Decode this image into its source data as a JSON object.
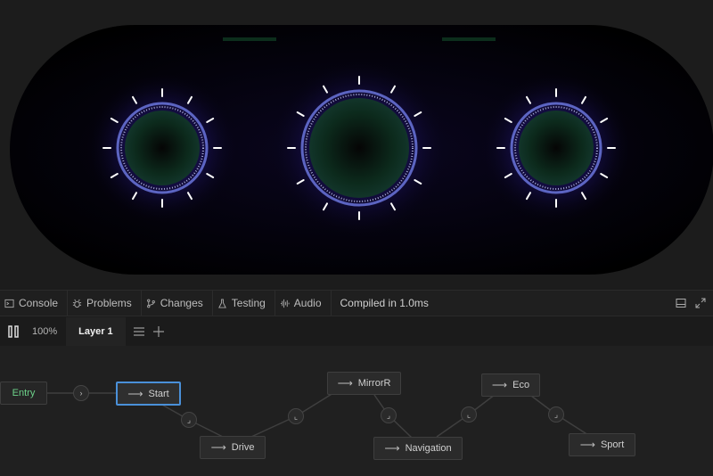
{
  "preview": {
    "gauges": [
      {
        "name": "left-gauge"
      },
      {
        "name": "center-gauge"
      },
      {
        "name": "right-gauge"
      }
    ],
    "colors": {
      "glow": "#5b4cff",
      "ring": "#7d8cff",
      "face": "#0a2418",
      "tick": "#ffffff"
    }
  },
  "tabbar": {
    "tabs": [
      {
        "label": "Console",
        "icon": "console-icon"
      },
      {
        "label": "Problems",
        "icon": "bug-icon"
      },
      {
        "label": "Changes",
        "icon": "branch-icon"
      },
      {
        "label": "Testing",
        "icon": "flask-icon"
      },
      {
        "label": "Audio",
        "icon": "waveform-icon"
      }
    ],
    "status": "Compiled in 1.0ms"
  },
  "layerbar": {
    "zoom": "100%",
    "layer_label": "Layer 1"
  },
  "graph": {
    "nodes": [
      {
        "label": "Entry",
        "kind": "entry"
      },
      {
        "label": "Start",
        "kind": "state",
        "selected": true
      },
      {
        "label": "Drive",
        "kind": "state"
      },
      {
        "label": "MirrorR",
        "kind": "state"
      },
      {
        "label": "Navigation",
        "kind": "state"
      },
      {
        "label": "Eco",
        "kind": "state"
      },
      {
        "label": "Sport",
        "kind": "state"
      }
    ],
    "colors": {
      "entry": "#6dd28a",
      "selected": "#4a90d9"
    }
  }
}
